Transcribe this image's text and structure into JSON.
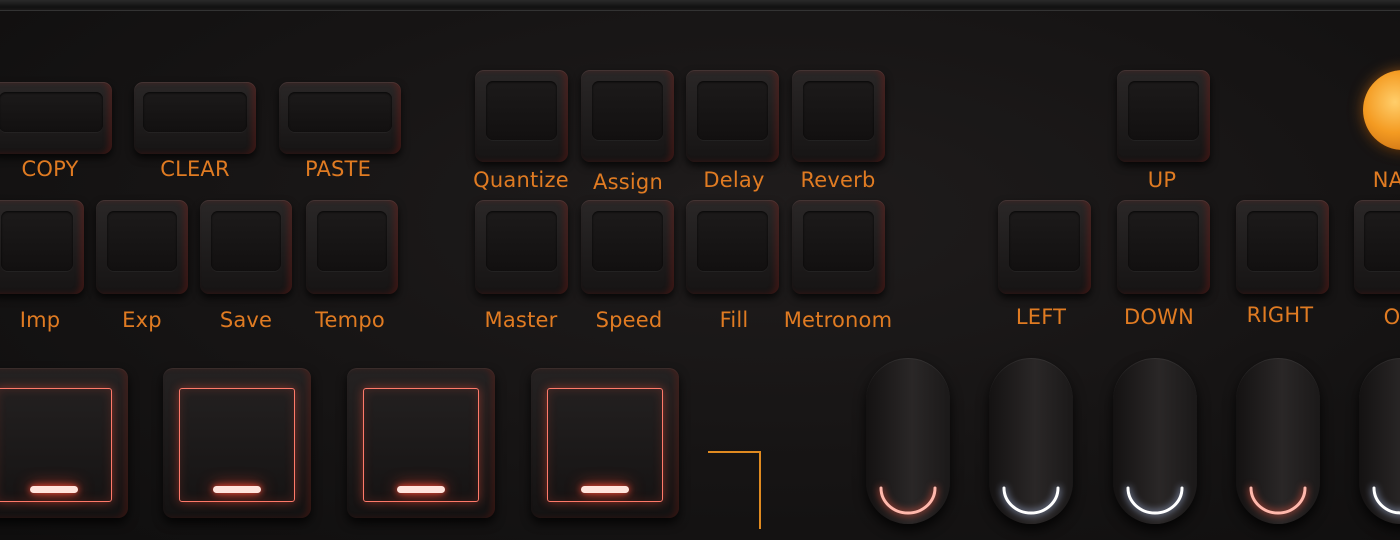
{
  "edit_row": {
    "copy": "COPY",
    "clear": "CLEAR",
    "paste": "PASTE"
  },
  "file_row": {
    "imp": "Imp",
    "exp": "Exp",
    "save": "Save",
    "tempo": "Tempo"
  },
  "function_row_1": {
    "quantize": "Quantize",
    "assign": "Assign",
    "delay": "Delay",
    "reverb": "Reverb"
  },
  "function_row_2": {
    "master": "Master",
    "speed": "Speed",
    "fill": "Fill",
    "metronom": "Metronom"
  },
  "navigation": {
    "up": "UP",
    "left": "LEFT",
    "down": "DOWN",
    "right": "RIGHT",
    "knob_label_partial": "NA",
    "cut_label_partial": "O"
  },
  "colors": {
    "label_orange": "#e07b22",
    "pad_glow": "#ff6a55",
    "knob_orange": "#f49b22",
    "panel": "#161414"
  },
  "icons": {
    "pad_indicator": "dash-bar-icon",
    "pill_indicator": "arc-icon",
    "panel_corner": "corner-bracket-icon"
  }
}
